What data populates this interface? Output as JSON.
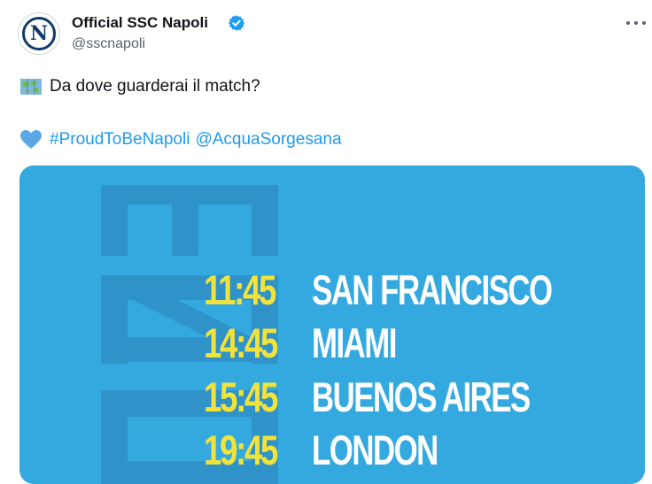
{
  "post": {
    "author": {
      "display_name": "Official SSC Napoli",
      "handle": "@sscnapoli",
      "avatar_letter": "N"
    },
    "text": {
      "line1": "Da dove guarderai il match?",
      "hashtag": "#ProudToBeNapoli",
      "mention": "@AcquaSorgesana"
    },
    "icons": {
      "line1_emoji": "world-map-icon",
      "line2_emoji": "blue-heart-icon",
      "verified": "verified-badge-icon",
      "menu": "more-options-icon"
    },
    "colors": {
      "link": "#1d9bf0",
      "media_bg": "#34a9e0",
      "time": "#f2e33b",
      "city": "#ffffff",
      "heart": "#5aa9e6"
    }
  },
  "media": {
    "schedule": [
      {
        "time": "11:45",
        "city": "SAN FRANCISCO"
      },
      {
        "time": "14:45",
        "city": "MIAMI"
      },
      {
        "time": "15:45",
        "city": "BUENOS AIRES"
      },
      {
        "time": "19:45",
        "city": "LONDON"
      }
    ]
  }
}
